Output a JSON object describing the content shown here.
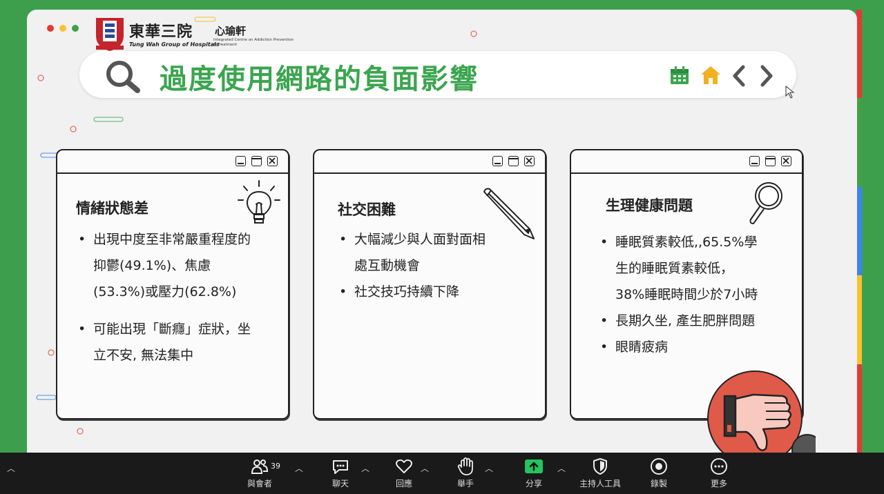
{
  "header": {
    "org_name_cn": "東華三院",
    "org_name_en": "Tung Wah Group of Hospitals",
    "centre_name_cn": "心瑜軒",
    "centre_name_en": "Integrated Centre on Addiction Prevention & Treatment",
    "title": "過度使用網路的負面影響"
  },
  "cards": [
    {
      "heading": "情緒狀態差",
      "bullets": [
        "出現中度至非常嚴重程度的抑鬱(49.1%)、焦慮(53.3%)或壓力(62.8%)",
        "可能出現「斷癮」症狀，坐立不安, 無法集中"
      ]
    },
    {
      "heading": "社交困難",
      "bullets": [
        "大幅減少與人面對面相處互動機會",
        "社交技巧持續下降"
      ]
    },
    {
      "heading": "生理健康問題",
      "bullets": [
        "睡眠質素較低,,65.5%學生的睡眠質素較低，38%睡眠時間少於7小時",
        "長期久坐, 產生肥胖問題",
        "眼睛疲病"
      ]
    }
  ],
  "toolbar": {
    "participants_label": "與會者",
    "participants_count": "39",
    "chat_label": "聊天",
    "reactions_label": "回應",
    "raise_hand_label": "舉手",
    "share_label": "分享",
    "host_tools_label": "主持人工具",
    "record_label": "錄製",
    "more_label": "更多"
  },
  "colors": {
    "background_green": "#3d9f4c",
    "title_green": "#3ba54f",
    "home_yellow": "#f2b01e",
    "share_green": "#22c55e",
    "thumb_red": "#e05a4a"
  }
}
